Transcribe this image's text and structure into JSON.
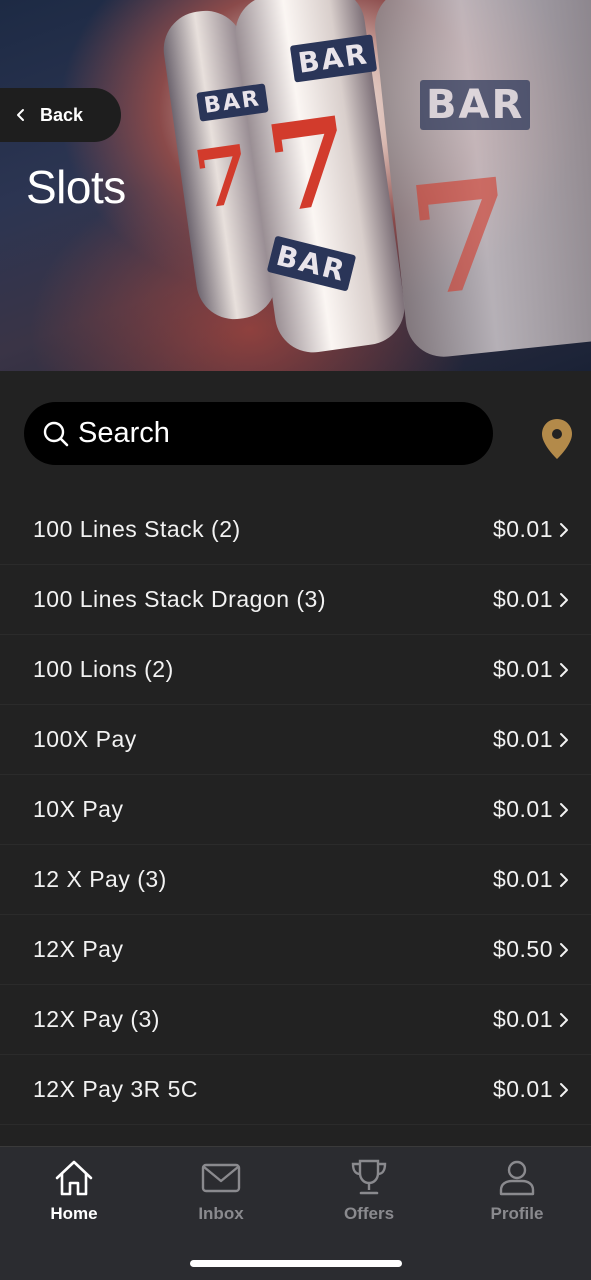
{
  "header": {
    "back_label": "Back",
    "title": "Slots",
    "banner_symbols": {
      "bar": "BAR",
      "seven": "7"
    }
  },
  "search": {
    "placeholder": "Search",
    "value": ""
  },
  "icons": {
    "search": "search-icon",
    "location": "location-pin-icon",
    "back": "chevron-left-icon",
    "row": "chevron-right-icon"
  },
  "colors": {
    "background": "#222222",
    "search_bg": "#000000",
    "pin": "#b38a4a",
    "tabbar": "#2b2c30",
    "active_tab": "#ffffff",
    "inactive_tab": "#8a8a8e"
  },
  "games": [
    {
      "name": "100 Lines Stack (2)",
      "price": "$0.01"
    },
    {
      "name": "100 Lines Stack Dragon (3)",
      "price": "$0.01"
    },
    {
      "name": "100 Lions (2)",
      "price": "$0.01"
    },
    {
      "name": "100X Pay",
      "price": "$0.01"
    },
    {
      "name": "10X Pay",
      "price": "$0.01"
    },
    {
      "name": "12 X Pay (3)",
      "price": "$0.01"
    },
    {
      "name": "12X Pay",
      "price": "$0.50"
    },
    {
      "name": "12X Pay (3)",
      "price": "$0.01"
    },
    {
      "name": "12X Pay 3R 5C",
      "price": "$0.01"
    }
  ],
  "tabs": [
    {
      "label": "Home",
      "icon": "home-icon",
      "active": true
    },
    {
      "label": "Inbox",
      "icon": "inbox-icon",
      "active": false
    },
    {
      "label": "Offers",
      "icon": "trophy-icon",
      "active": false
    },
    {
      "label": "Profile",
      "icon": "profile-icon",
      "active": false
    }
  ]
}
